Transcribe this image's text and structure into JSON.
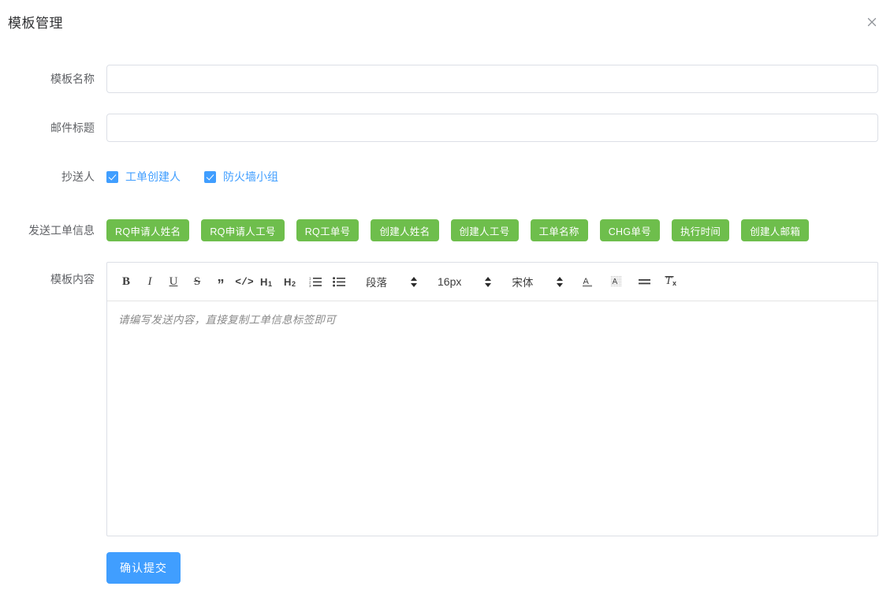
{
  "dialog": {
    "title": "模板管理",
    "close_icon": "close-icon"
  },
  "form": {
    "template_name": {
      "label": "模板名称",
      "value": "",
      "placeholder": ""
    },
    "mail_subject": {
      "label": "邮件标题",
      "value": "",
      "placeholder": ""
    },
    "cc": {
      "label": "抄送人",
      "options": [
        {
          "label": "工单创建人",
          "checked": true
        },
        {
          "label": "防火墙小组",
          "checked": true
        }
      ]
    },
    "ticket_info": {
      "label": "发送工单信息",
      "tags": [
        "RQ申请人姓名",
        "RQ申请人工号",
        "RQ工单号",
        "创建人姓名",
        "创建人工号",
        "工单名称",
        "CHG单号",
        "执行时间",
        "创建人邮箱"
      ]
    },
    "content": {
      "label": "模板内容",
      "placeholder": "请编写发送内容，直接复制工单信息标签即可",
      "value": ""
    }
  },
  "editor_toolbar": {
    "buttons": [
      {
        "name": "bold-icon",
        "glyph": "B"
      },
      {
        "name": "italic-icon",
        "glyph": "I"
      },
      {
        "name": "underline-icon",
        "glyph": "U"
      },
      {
        "name": "strikethrough-icon",
        "glyph": "S"
      },
      {
        "name": "blockquote-icon",
        "glyph": "”"
      },
      {
        "name": "code-icon",
        "glyph": "</>"
      },
      {
        "name": "heading-1-icon",
        "glyph": "H1"
      },
      {
        "name": "heading-2-icon",
        "glyph": "H2"
      },
      {
        "name": "ordered-list-icon",
        "glyph": "1."
      },
      {
        "name": "unordered-list-icon",
        "glyph": "•"
      }
    ],
    "selects": [
      {
        "name": "paragraph-style-select",
        "value": "段落"
      },
      {
        "name": "font-size-select",
        "value": "16px"
      },
      {
        "name": "font-family-select",
        "value": "宋体"
      }
    ],
    "right_buttons": [
      {
        "name": "text-color-icon",
        "glyph": "A"
      },
      {
        "name": "highlight-color-icon",
        "glyph": "A"
      },
      {
        "name": "align-icon",
        "glyph": "≡"
      },
      {
        "name": "clear-format-icon",
        "glyph": "Tx"
      }
    ]
  },
  "actions": {
    "submit_label": "确认提交"
  },
  "colors": {
    "accent_blue": "#409eff",
    "tag_green": "#6ebe4c",
    "border": "#dcdfe6",
    "label_text": "#606266"
  }
}
